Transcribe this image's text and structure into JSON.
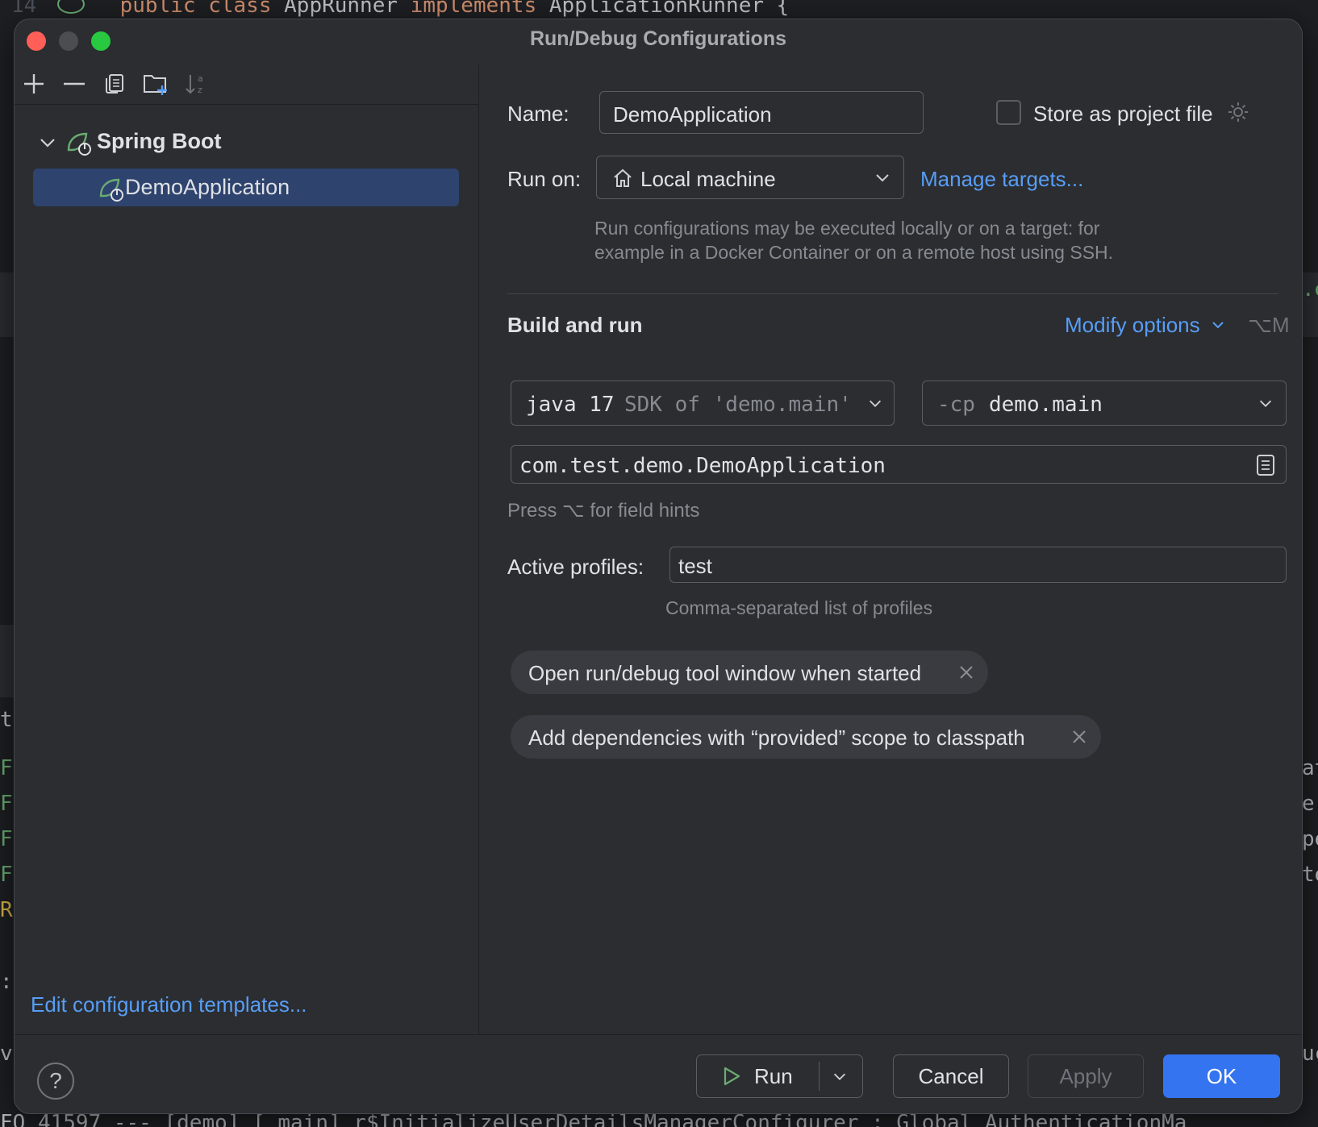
{
  "background": {
    "code_line_number": "14",
    "code_line": [
      "public",
      "class",
      "AppRunner",
      "implements",
      "ApplicationRunner",
      "{"
    ],
    "left_gutter": [
      "tu",
      "F",
      "F",
      "F",
      "F",
      "R",
      ":",
      "v"
    ],
    "right_gutter": [
      ".e",
      "at",
      "e:",
      "pe",
      "te",
      "uc"
    ],
    "bottom_line": "FO 41597 --- [demo] [          main] r$InitializeUserDetailsManagerConfigurer : Global AuthenticationMa"
  },
  "dialog": {
    "title": "Run/Debug Configurations"
  },
  "sidebar": {
    "toolbar": [
      "add-icon",
      "remove-icon",
      "copy-icon",
      "new-folder-icon",
      "sort-icon"
    ],
    "group": {
      "label": "Spring Boot",
      "icon": "spring-boot-icon",
      "expanded": true
    },
    "items": [
      {
        "label": "DemoApplication",
        "selected": true
      }
    ],
    "edit_templates_link": "Edit configuration templates..."
  },
  "config": {
    "name_label": "Name:",
    "name_value": "DemoApplication",
    "store_label": "Store as project file",
    "store_checked": false,
    "run_on_label": "Run on:",
    "run_on_value": "Local machine",
    "manage_targets": "Manage targets...",
    "run_on_hint_1": "Run configurations may be executed locally or on a target: for",
    "run_on_hint_2": "example in a Docker Container or on a remote host using SSH.",
    "build_section": "Build and run",
    "modify_options": "Modify options",
    "modify_shortcut": "⌥M",
    "jdk_main": "java 17",
    "jdk_detail": "SDK of 'demo.main'",
    "cp_prefix": "-cp",
    "cp_value": "demo.main",
    "main_class": "com.test.demo.DemoApplication",
    "field_hint": "Press ⌥ for field hints",
    "profiles_label": "Active profiles:",
    "profiles_value": "test",
    "profiles_hint": "Comma-separated list of profiles",
    "chips": [
      "Open run/debug tool window when started",
      "Add dependencies with “provided” scope to classpath"
    ]
  },
  "footer": {
    "help": "?",
    "run": "Run",
    "cancel": "Cancel",
    "apply": "Apply",
    "ok": "OK"
  },
  "colors": {
    "accent": "#3574f0",
    "link": "#589df6",
    "selection": "#2e436e",
    "spring_green": "#6aab73"
  }
}
